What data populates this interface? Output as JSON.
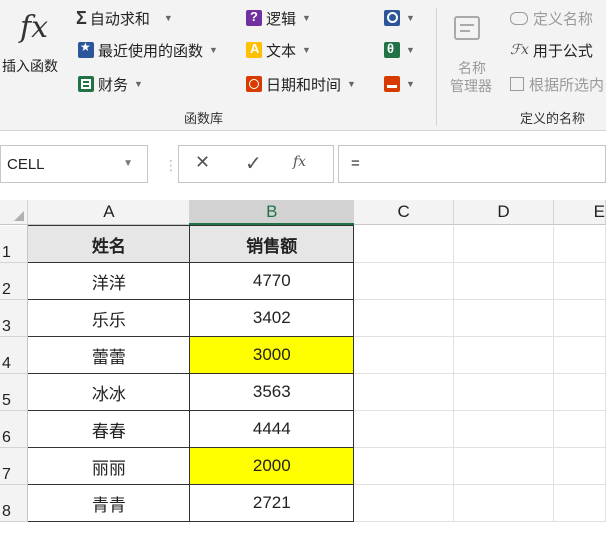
{
  "ribbon": {
    "insert_function": {
      "icon_text": "fx",
      "label": "插入函数"
    },
    "autosum": {
      "symbol": "Σ",
      "label": "自动求和"
    },
    "recent": {
      "label": "最近使用的函数"
    },
    "financial": {
      "label": "财务"
    },
    "logical": {
      "label": "逻辑"
    },
    "text": {
      "label": "文本"
    },
    "datetime": {
      "label": "日期和时间"
    },
    "name_manager": {
      "line1": "名称",
      "line2": "管理器"
    },
    "define_name": {
      "label": "定义名称"
    },
    "use_in_formula": {
      "label": "用于公式"
    },
    "create_from_selection": {
      "label": "根据所选内"
    },
    "group_function_library": "函数库",
    "group_defined_names": "定义的名称",
    "icon_colors": {
      "recent": "#2b579a",
      "financial": "#217346",
      "logical": "#7030a0",
      "text": "#ffc000",
      "datetime": "#d83b01"
    }
  },
  "formula_bar": {
    "name_box": "CELL",
    "cancel_symbol": "✕",
    "enter_symbol": "✓",
    "fx_symbol": "fx",
    "formula": "="
  },
  "sheet": {
    "columns": [
      "A",
      "B",
      "C",
      "D",
      "E"
    ],
    "rows": [
      {
        "num": "1",
        "a": "姓名",
        "b": "销售额",
        "highlight": false,
        "header": true
      },
      {
        "num": "2",
        "a": "洋洋",
        "b": "4770",
        "highlight": false
      },
      {
        "num": "3",
        "a": "乐乐",
        "b": "3402",
        "highlight": false
      },
      {
        "num": "4",
        "a": "蕾蕾",
        "b": "3000",
        "highlight": true
      },
      {
        "num": "5",
        "a": "冰冰",
        "b": "3563",
        "highlight": false
      },
      {
        "num": "6",
        "a": "春春",
        "b": "4444",
        "highlight": false
      },
      {
        "num": "7",
        "a": "丽丽",
        "b": "2000",
        "highlight": true
      },
      {
        "num": "8",
        "a": "青青",
        "b": "2721",
        "highlight": false
      }
    ],
    "colors": {
      "highlight": "#ffff00",
      "header_fill": "#e7e6e6"
    }
  }
}
